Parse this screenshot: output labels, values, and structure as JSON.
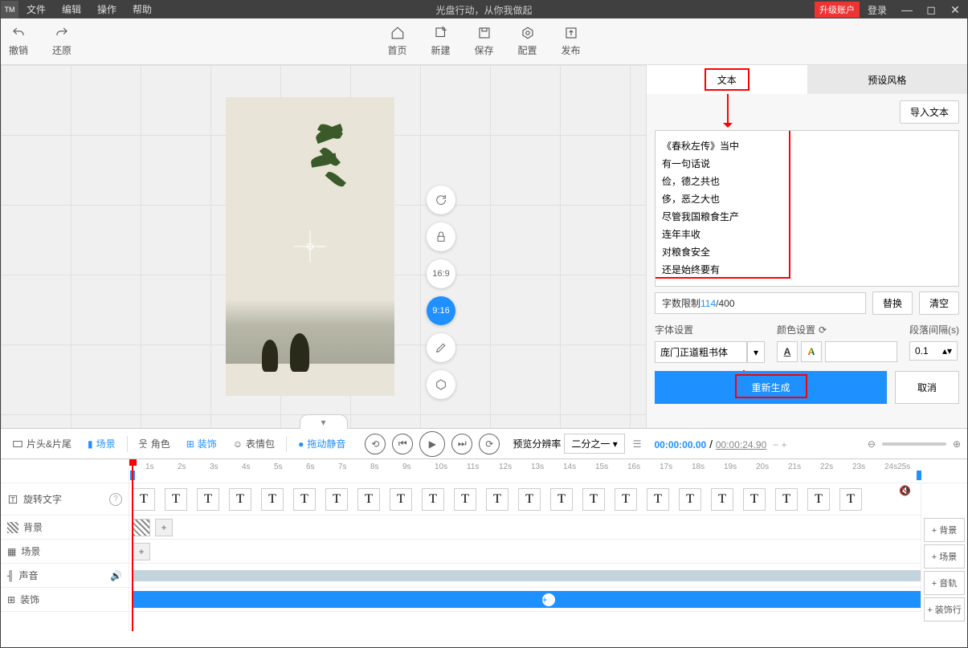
{
  "titlebar": {
    "logo": "TM",
    "menus": [
      "文件",
      "编辑",
      "操作",
      "帮助"
    ],
    "title": "光盘行动，从你我做起",
    "upgrade": "升级账户",
    "login": "登录"
  },
  "toolbar": {
    "undo": "撤销",
    "redo": "还原",
    "home": "首页",
    "new": "新建",
    "save": "保存",
    "config": "配置",
    "publish": "发布"
  },
  "ratios": {
    "r1": "16:9",
    "r2": "9:16"
  },
  "side": {
    "tab_text": "文本",
    "tab_style": "预设风格",
    "import": "导入文本",
    "content": "《春秋左传》当中\n有一句话说\n俭，德之共也\n侈，恶之大也\n尽管我国粮食生产\n连年丰收\n对粮食安全\n还是始终要有",
    "count_label": "字数限制",
    "count_cur": "114",
    "count_max": "/400",
    "replace": "替换",
    "clear": "清空",
    "font_label": "字体设置",
    "font_value": "庞门正道粗书体",
    "color_label": "颜色设置",
    "gap_label": "段落间隔(s)",
    "gap_value": "0.1",
    "regen": "重新生成",
    "cancel": "取消"
  },
  "tl": {
    "tabs": {
      "head": "片头&片尾",
      "scene": "场景",
      "role": "角色",
      "deco": "装饰",
      "emoji": "表情包",
      "dragmute": "拖动静音"
    },
    "res_label": "预览分辨率",
    "res_value": "二分之一",
    "time_cur": "00:00:00.00",
    "time_tot": "00:00:24.90",
    "rows": {
      "text": "旋转文字",
      "bg": "背景",
      "scene": "场景",
      "sound": "声音",
      "deco": "装饰"
    },
    "add": {
      "bg": "+ 背景",
      "scene": "+ 场景",
      "audio": "+ 音轨",
      "deco": "+ 装饰行"
    },
    "ticks": [
      "1s",
      "2s",
      "3s",
      "4s",
      "5s",
      "6s",
      "7s",
      "8s",
      "9s",
      "10s",
      "11s",
      "12s",
      "13s",
      "14s",
      "15s",
      "16s",
      "17s",
      "18s",
      "19s",
      "20s",
      "21s",
      "22s",
      "23s",
      "24s25s"
    ]
  }
}
